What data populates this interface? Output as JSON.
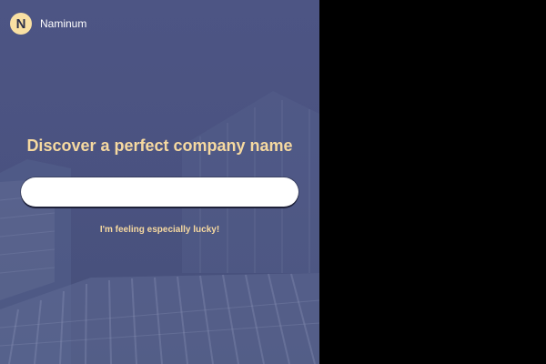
{
  "brand": {
    "logo_letter": "N",
    "name": "Naminum"
  },
  "hero": {
    "headline": "Discover a perfect company name",
    "search_value": "",
    "search_placeholder": "",
    "lucky_link": "I'm feeling especially lucky!"
  },
  "colors": {
    "panel_bg": "#4d5584",
    "accent_text": "#f6d9a0",
    "logo_bg": "#f9e0a3",
    "outside_bg": "#000000"
  }
}
